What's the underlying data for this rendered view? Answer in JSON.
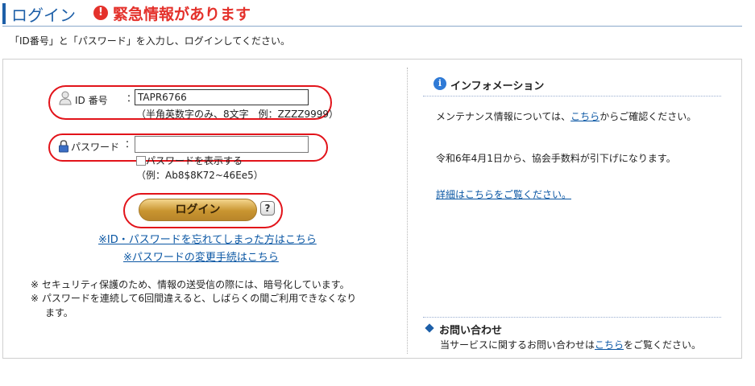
{
  "header": {
    "title": "ログイン",
    "alert_icon": "!",
    "alert_text": "緊急情報があります",
    "instruction": "「ID番号」と「パスワード」を入力し、ログインしてください。"
  },
  "login": {
    "id_label": "ID 番号",
    "colon": "：",
    "id_value": "TAPR6766",
    "id_hint": "（半角英数字のみ、8文字　例：ZZZZ9999）",
    "password_label": "パスワード",
    "password_value": "",
    "show_password_label": "パスワードを表示する",
    "password_example": "（例：Ab8$8K72~46Ee5）",
    "login_button": "ログイン",
    "help_icon": "?",
    "forgot_link": "※ID・パスワードを忘れてしまった方はこちら",
    "change_password_link": "※パスワードの変更手続はこちら",
    "notes": [
      "※ セキュリティ保護のため、情報の送受信の際には、暗号化しています。",
      "※ パスワードを連続して6回間違えると、しばらくの間ご利用できなくなり",
      "ます。"
    ]
  },
  "info": {
    "icon": "i",
    "title": "インフォメーション",
    "maintenance_prefix": "メンテナンス情報については、",
    "maintenance_link": "こちら",
    "maintenance_suffix": "からご確認ください。",
    "fee_notice": "令和6年4月1日から、協会手数料が引下げになります。",
    "details_link": "詳細はこちらをご覧ください。"
  },
  "contact": {
    "title": "お問い合わせ",
    "text_prefix": "当サービスに関するお問い合わせは",
    "link": "こちら",
    "text_suffix": "をご覧ください。"
  },
  "colors": {
    "accent_blue": "#1d5fa8",
    "alert_red": "#e4312b",
    "annotation_red": "#e2131a",
    "link_blue": "#0b57a4",
    "button_gold": "#c99530"
  }
}
